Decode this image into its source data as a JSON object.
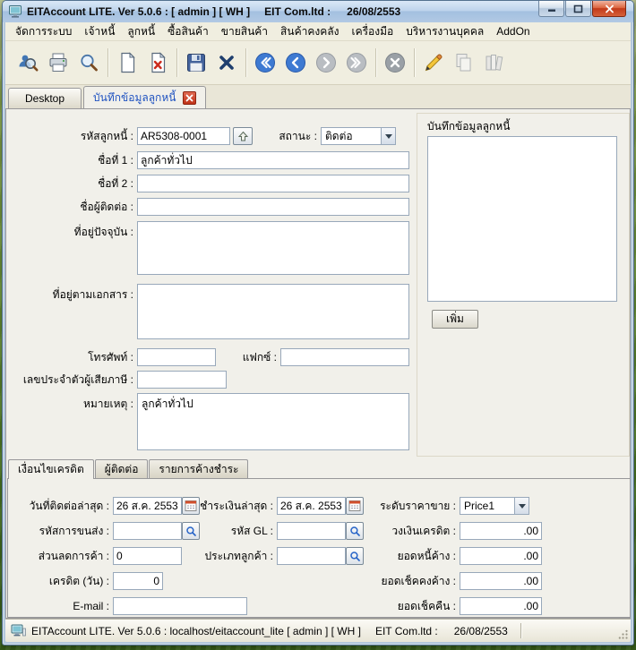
{
  "window": {
    "title_app": "EITAccount LITE. Ver 5.0.6 : [ admin ] [ WH ]",
    "title_company": "EIT Com.ltd :",
    "title_date": "26/08/2553"
  },
  "menu": {
    "items": [
      "จัดการระบบ",
      "เจ้าหนี้",
      "ลูกหนี้",
      "ซื้อสินค้า",
      "ขายสินค้า",
      "สินค้าคงคลัง",
      "เครื่องมือ",
      "บริหารงานบุคคล",
      "AddOn"
    ]
  },
  "tabs": {
    "desktop": "Desktop",
    "record": "บันทึกข้อมูลลูกหนี้"
  },
  "form": {
    "code": {
      "label": "รหัสลูกหนี้ :",
      "value": "AR5308-0001"
    },
    "status": {
      "label": "สถานะ :",
      "value": "ติดต่อ"
    },
    "name1": {
      "label": "ชื่อที่ 1 :",
      "value": "ลูกค้าทั่วไป"
    },
    "name2": {
      "label": "ชื่อที่ 2 :",
      "value": ""
    },
    "contact": {
      "label": "ชื่อผู้ติดต่อ :",
      "value": ""
    },
    "address_current": {
      "label": "ที่อยู่ปัจจุบัน :",
      "value": ""
    },
    "address_document": {
      "label": "ที่อยู่ตามเอกสาร :",
      "value": ""
    },
    "phone": {
      "label": "โทรศัพท์ :",
      "value": ""
    },
    "fax": {
      "label": "แฟกซ์ :",
      "value": ""
    },
    "tax_id": {
      "label": "เลขประจำตัวผู้เสียภาษี :",
      "value": ""
    },
    "remark": {
      "label": "หมายเหตุ :",
      "value": "ลูกค้าทั่วไป"
    }
  },
  "notes_panel": {
    "title": "บันทึกข้อมูลลูกหนี้",
    "add_button": "เพิ่ม"
  },
  "detail_tabs": [
    "เงื่อนไขเครดิต",
    "ผู้ติดต่อ",
    "รายการค้างชำระ"
  ],
  "credit": {
    "last_contact": {
      "label": "วันที่ติดต่อล่าสุด :",
      "value": "26 ส.ค. 2553"
    },
    "last_payment": {
      "label": "ชำระเงินล่าสุด :",
      "value": "26 ส.ค. 2553"
    },
    "price_level": {
      "label": "ระดับราคาขาย :",
      "value": "Price1"
    },
    "shipping_code": {
      "label": "รหัสการขนส่ง :",
      "value": ""
    },
    "gl_code": {
      "label": "รหัส GL :",
      "value": ""
    },
    "credit_limit": {
      "label": "วงเงินเครดิต :",
      "value": ".00"
    },
    "trade_discount": {
      "label": "ส่วนลดการค้า :",
      "value": "0"
    },
    "customer_type": {
      "label": "ประเภทลูกค้า :",
      "value": ""
    },
    "outstanding_balance": {
      "label": "ยอดหนี้ค้าง :",
      "value": ".00"
    },
    "credit_days": {
      "label": "เครดิต (วัน) :",
      "value": "0"
    },
    "pending_cheque": {
      "label": "ยอดเช็คคงค้าง :",
      "value": ".00"
    },
    "email": {
      "label": "E-mail :",
      "value": ""
    },
    "returned_cheque": {
      "label": "ยอดเช็คคืน :",
      "value": ".00"
    }
  },
  "status_bar": {
    "app": "EITAccount  LITE. Ver 5.0.6 : localhost/eitaccount_lite   [ admin ] [ WH ]",
    "company": "EIT Com.ltd :",
    "date": "26/08/2553"
  },
  "colors": {
    "titlebar_blue": "#b2c9e4",
    "active_tab_text": "#1f52c0",
    "close_red": "#c23a1a",
    "panel_gray": "#f1f0ea"
  }
}
